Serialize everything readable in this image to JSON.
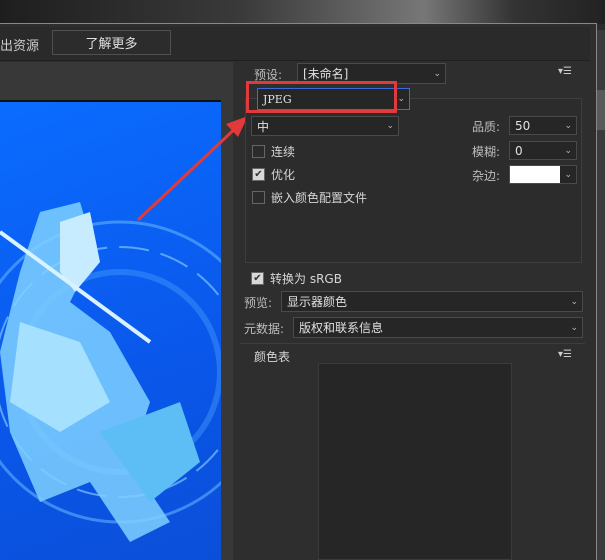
{
  "toolbar": {
    "partial_label": "出资源",
    "learn_more": "了解更多"
  },
  "settings": {
    "preset_label": "预设:",
    "preset_value": "[未命名]",
    "format": "JPEG",
    "quality_level": "中",
    "quality_label": "品质:",
    "quality_value": "50",
    "blur_label": "模糊:",
    "blur_value": "0",
    "matte_label": "杂边:",
    "matte_color": "#ffffff",
    "progressive": {
      "label": "连续",
      "checked": false
    },
    "optimized": {
      "label": "优化",
      "checked": true
    },
    "embed_profile": {
      "label": "嵌入颜色配置文件",
      "checked": false
    },
    "convert_srgb": {
      "label": "转换为 sRGB",
      "checked": true
    },
    "preview_label": "预览:",
    "preview_value": "显示器颜色",
    "metadata_label": "元数据:",
    "metadata_value": "版权和联系信息",
    "color_table_label": "颜色表"
  },
  "colors": {
    "highlight": "#e03a3a",
    "preview_bg": "#0a62f5"
  }
}
